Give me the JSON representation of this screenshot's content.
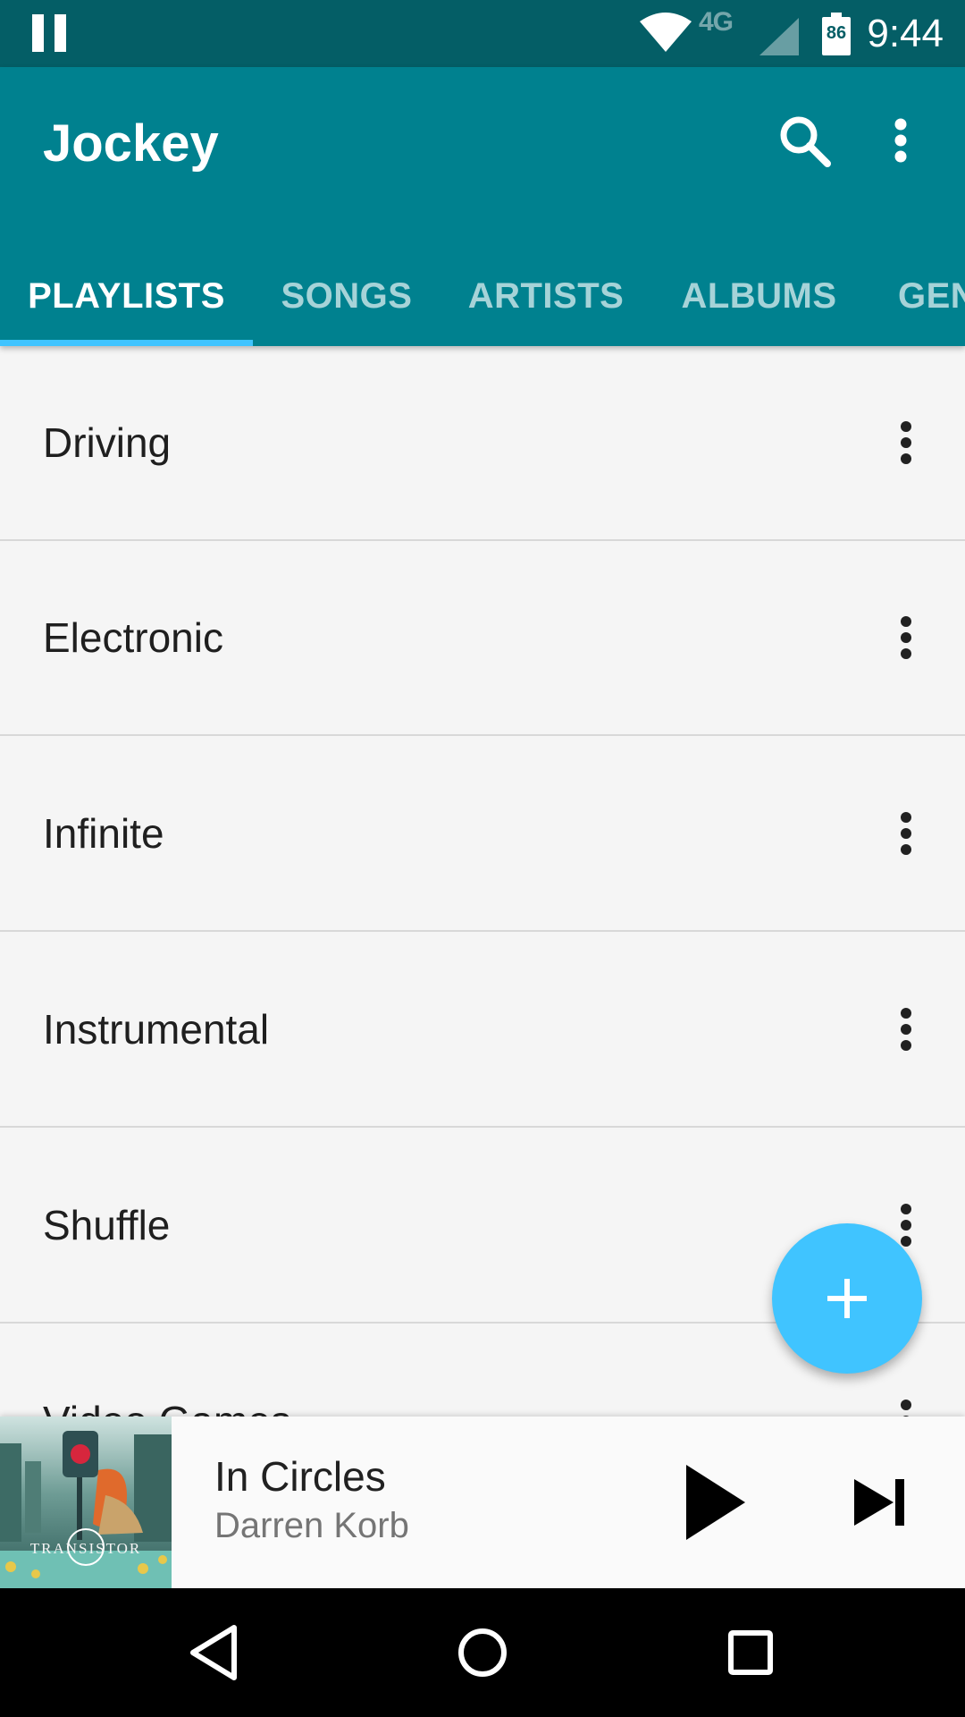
{
  "status_bar": {
    "network_label": "4G",
    "battery_level": "86",
    "time": "9:44",
    "icons": [
      "pause-icon",
      "wifi-icon",
      "lte-icon",
      "cell-signal-icon",
      "battery-icon"
    ]
  },
  "app_bar": {
    "title": "Jockey",
    "actions": [
      "search-icon",
      "more-vert-icon"
    ]
  },
  "tabs": [
    {
      "label": "PLAYLISTS",
      "active": true
    },
    {
      "label": "SONGS",
      "active": false
    },
    {
      "label": "ARTISTS",
      "active": false
    },
    {
      "label": "ALBUMS",
      "active": false
    },
    {
      "label": "GEN",
      "active": false
    }
  ],
  "playlists": [
    {
      "label": "Driving"
    },
    {
      "label": "Electronic"
    },
    {
      "label": "Infinite"
    },
    {
      "label": "Instrumental"
    },
    {
      "label": "Shuffle"
    },
    {
      "label": "Video Games"
    }
  ],
  "fab": {
    "icon": "plus-icon"
  },
  "now_playing": {
    "title": "In Circles",
    "artist": "Darren Korb",
    "album_art_text": "TRANSISTOR",
    "controls": [
      "play-icon",
      "skip-next-icon"
    ]
  },
  "nav_bar": {
    "buttons": [
      "back-icon",
      "home-icon",
      "recents-icon"
    ]
  },
  "colors": {
    "status_bar": "#045e66",
    "primary": "#00818f",
    "accent": "#40c4ff",
    "list_background": "#f5f5f5"
  }
}
